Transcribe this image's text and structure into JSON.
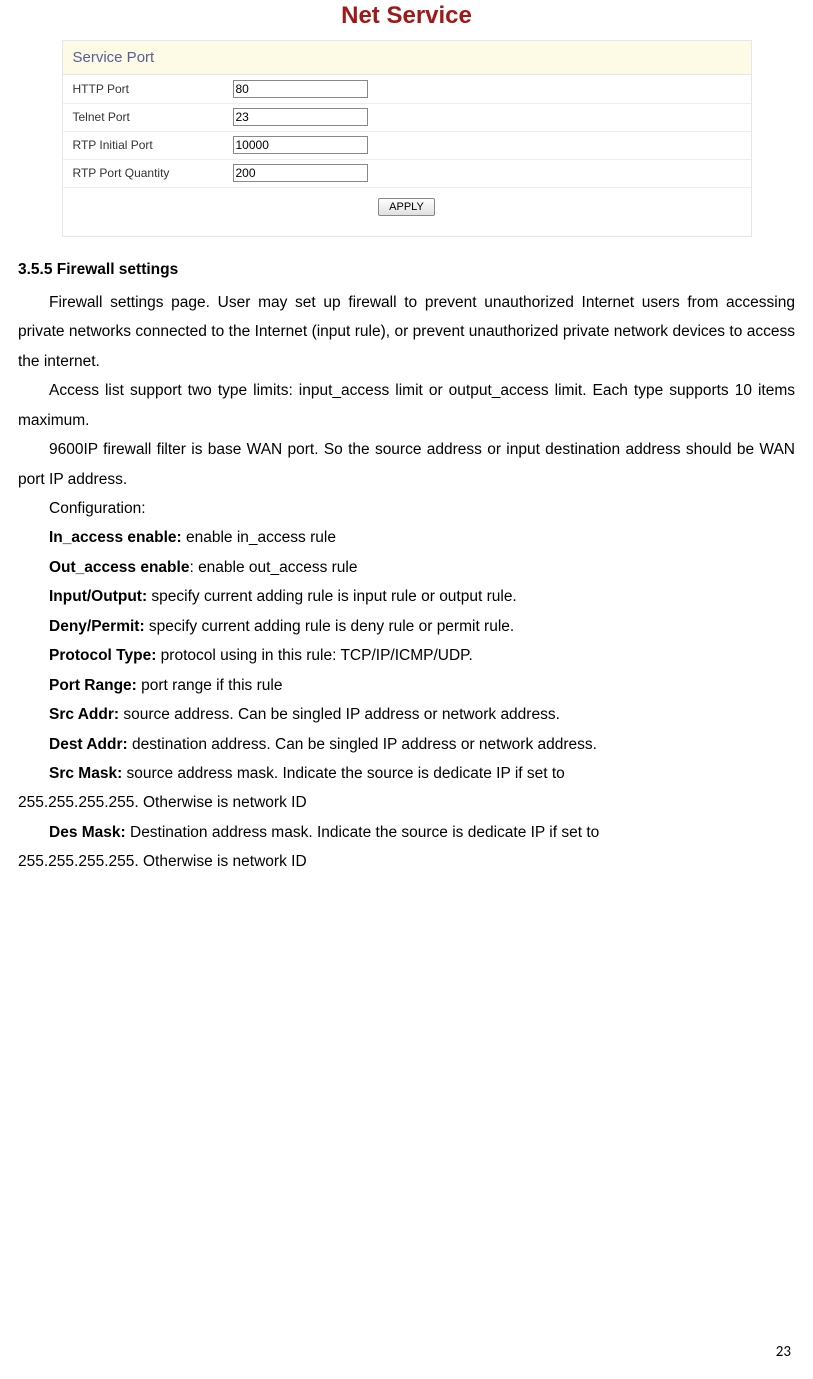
{
  "title": "Net Service",
  "form": {
    "sectionHeader": "Service Port",
    "rows": [
      {
        "label": "HTTP Port",
        "value": "80"
      },
      {
        "label": "Telnet Port",
        "value": "23"
      },
      {
        "label": "RTP Initial Port",
        "value": "10000"
      },
      {
        "label": "RTP Port Quantity",
        "value": "200"
      }
    ],
    "applyLabel": "APPLY"
  },
  "doc": {
    "sectionHeading": "3.5.5 Firewall settings",
    "p1": "Firewall settings page. User may set up firewall to prevent unauthorized Internet users from accessing private networks connected to the Internet (input rule), or prevent unauthorized private network devices to access the internet.",
    "p2": "Access list support two type limits: input_access limit or output_access limit. Each type supports 10 items maximum.",
    "p3": "9600IP firewall filter is base WAN port. So the source address or input destination address should be WAN port IP address.",
    "configLabel": "Configuration:",
    "defs": [
      {
        "label": "In_access enable:",
        "text": " enable in_access rule"
      },
      {
        "label": "Out_access enable",
        "text": ": enable out_access rule"
      },
      {
        "label": "Input/Output:",
        "text": " specify current adding rule is input rule or output rule."
      },
      {
        "label": "Deny/Permit:",
        "text": " specify current adding rule is deny rule or permit rule."
      },
      {
        "label": "Protocol Type:",
        "text": " protocol using in this rule: TCP/IP/ICMP/UDP."
      },
      {
        "label": "Port Range:",
        "text": "    port range if this rule"
      },
      {
        "label": "Src Addr:",
        "text": " source address. Can be singled IP address or network address."
      },
      {
        "label": "Dest Addr:",
        "text": " destination address. Can be singled IP address or network address."
      }
    ],
    "srcMaskLabel": "Src Mask:",
    "srcMaskLine1": " source address mask. Indicate the source is dedicate IP if set to",
    "srcMaskLine2": "255.255.255.255. Otherwise is network ID",
    "desMaskLabel": "Des Mask:",
    "desMaskLine1": " Destination address mask. Indicate the source is dedicate IP if set to",
    "desMaskLine2": "255.255.255.255. Otherwise is network ID"
  },
  "pageNumber": "23"
}
